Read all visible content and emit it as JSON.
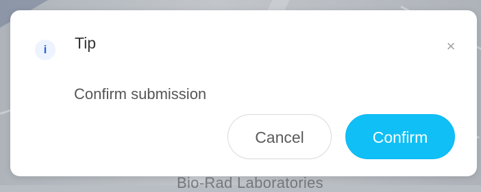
{
  "background": {
    "partial_map_text": "Bio-Rad Laboratories"
  },
  "dialog": {
    "icon_glyph": "i",
    "title": "Tip",
    "close_glyph": "×",
    "message": "Confirm submission",
    "cancel_label": "Cancel",
    "confirm_label": "Confirm"
  },
  "colors": {
    "accent": "#10bff5",
    "info_icon": "#2a63d6",
    "info_icon_background": "#edf3ff"
  },
  "icons": {
    "info": "info-icon",
    "close": "close-icon"
  }
}
